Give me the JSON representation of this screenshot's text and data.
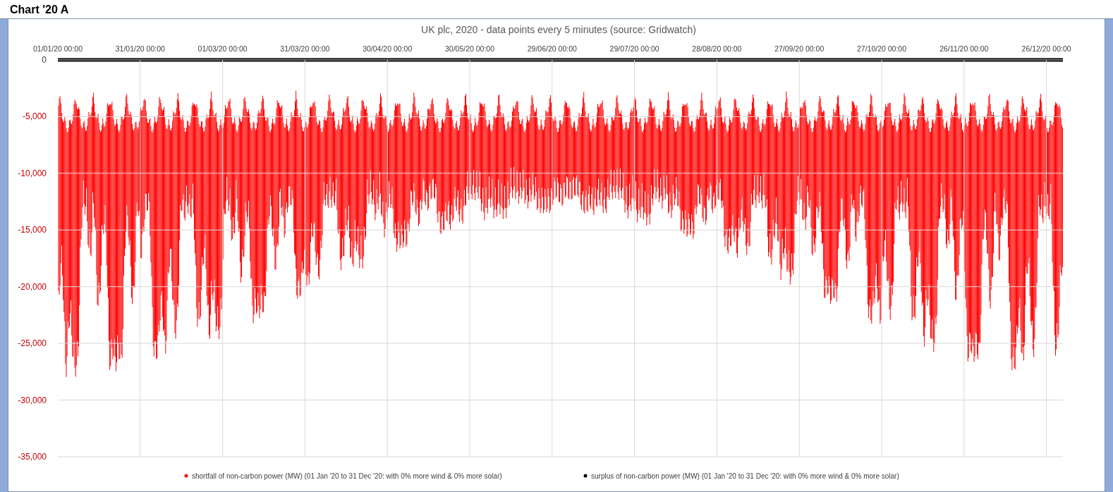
{
  "sheet_title": "Chart '20 A",
  "chart": {
    "chart_data": {
      "type": "scatter",
      "title": "UK plc, 2020 - data points every 5 minutes (source: Gridwatch)",
      "grid": true,
      "categories": [
        "01/01/20 00:00",
        "31/01/20 00:00",
        "01/03/20 00:00",
        "31/03/20 00:00",
        "30/04/20 00:00",
        "30/05/20 00:00",
        "29/06/20 00:00",
        "29/07/20 00:00",
        "28/08/20 00:00",
        "27/09/20 00:00",
        "27/10/20 00:00",
        "26/11/20 00:00",
        "26/12/20 00:00"
      ],
      "yticks": [
        {
          "value": 0,
          "label": "0"
        },
        {
          "value": -5000,
          "label": "-5,000"
        },
        {
          "value": -10000,
          "label": "-10,000"
        },
        {
          "value": -15000,
          "label": "-15,000"
        },
        {
          "value": -20000,
          "label": "-20,000"
        },
        {
          "value": -25000,
          "label": "-25,000"
        },
        {
          "value": -30000,
          "label": "-30,000"
        },
        {
          "value": -35000,
          "label": "-35,000"
        }
      ],
      "ylim": [
        -35000,
        0
      ]
    },
    "legend": [
      {
        "name": "shortfall of non-carbon power (MW) (01 Jan '20 to 31 Dec '20: with 0% more wind & 0% more solar)",
        "color": "#ff0000"
      },
      {
        "name": "surplus of non-carbon power (MW) (01 Jan '20 to 31 Dec '20: with 0% more wind & 0% more solar)",
        "color": "#000000"
      }
    ]
  }
}
